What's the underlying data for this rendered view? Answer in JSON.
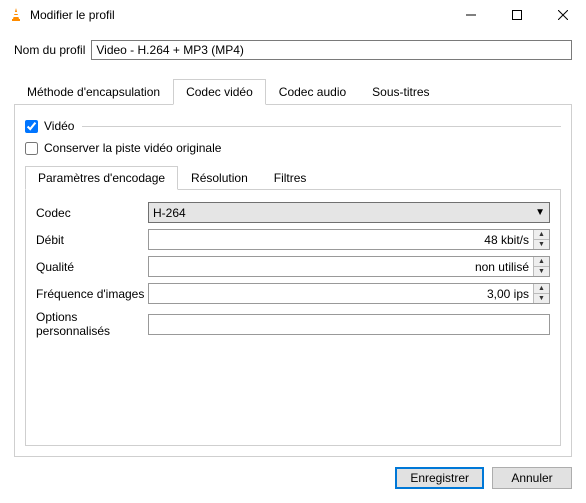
{
  "window": {
    "title": "Modifier le profil"
  },
  "profile": {
    "label": "Nom du profil",
    "value": "Video - H.264 + MP3 (MP4)"
  },
  "tabs": {
    "encapsulation": "Méthode d'encapsulation",
    "video": "Codec vidéo",
    "audio": "Codec audio",
    "subtitles": "Sous-titres"
  },
  "video": {
    "enable_label": "Vidéo",
    "keep_original_label": "Conserver la piste vidéo originale",
    "inner_tabs": {
      "encoding": "Paramètres d'encodage",
      "resolution": "Résolution",
      "filters": "Filtres"
    },
    "form": {
      "codec_label": "Codec",
      "codec_value": "H-264",
      "bitrate_label": "Débit",
      "bitrate_value": "48 kbit/s",
      "quality_label": "Qualité",
      "quality_value": "non utilisé",
      "fps_label": "Fréquence d'images",
      "fps_value": "3,00 ips",
      "custom_label": "Options personnalisés",
      "custom_value": ""
    }
  },
  "footer": {
    "save": "Enregistrer",
    "cancel": "Annuler"
  }
}
